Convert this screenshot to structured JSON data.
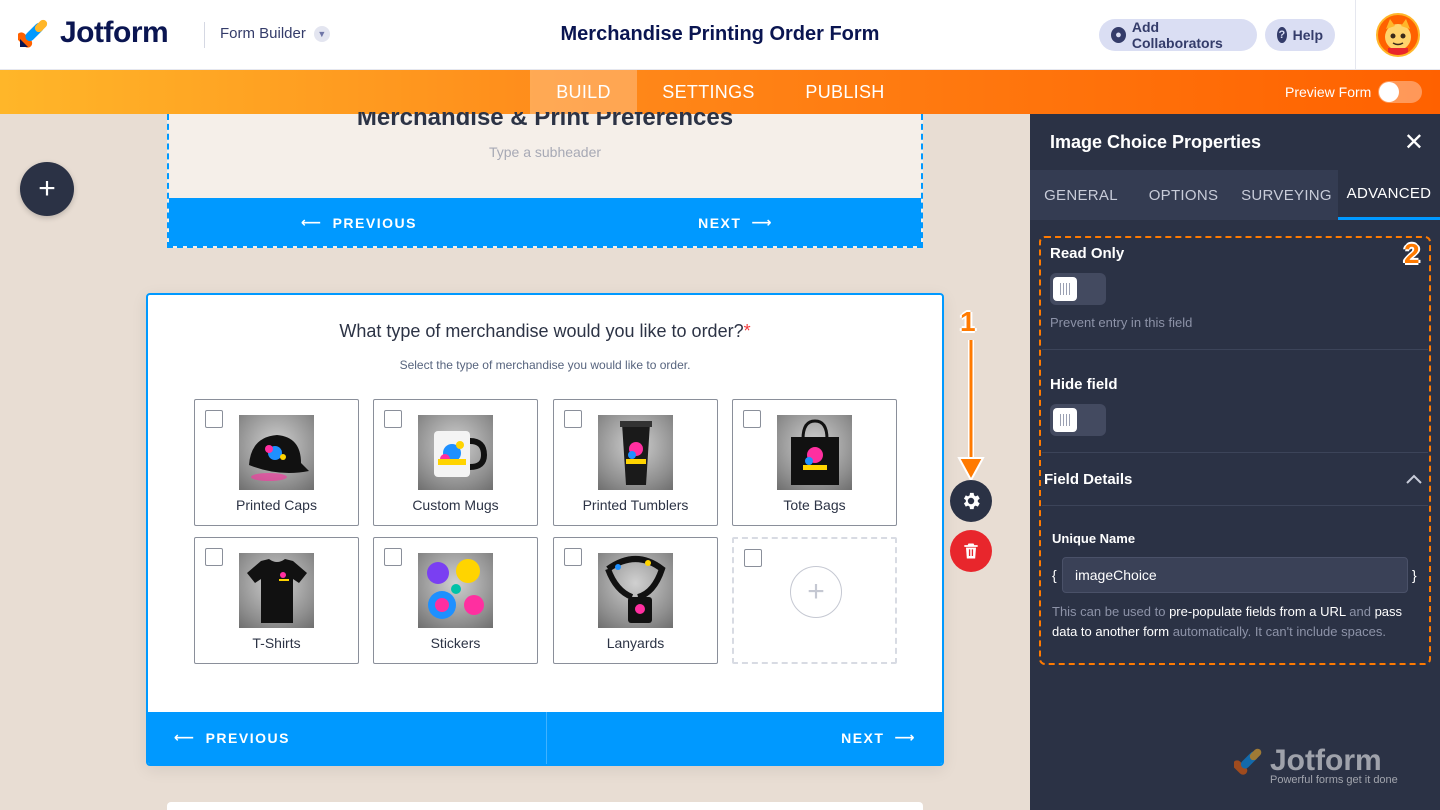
{
  "header": {
    "logo_text": "Jotform",
    "form_builder_label": "Form Builder",
    "form_title": "Merchandise Printing Order Form",
    "add_collaborators": "Add Collaborators",
    "help": "Help"
  },
  "navbar": {
    "tabs": [
      {
        "label": "BUILD",
        "active": true
      },
      {
        "label": "SETTINGS",
        "active": false
      },
      {
        "label": "PUBLISH",
        "active": false
      }
    ],
    "preview_label": "Preview Form",
    "preview_enabled": false
  },
  "prev_page": {
    "heading": "Merchandise & Print Preferences",
    "subheader_placeholder": "Type a subheader",
    "previous": "PREVIOUS",
    "next": "NEXT"
  },
  "question": {
    "title": "What type of merchandise would you like to order?",
    "required_mark": "*",
    "subtitle": "Select the type of merchandise you would like to order.",
    "choices": [
      {
        "label": "Printed Caps",
        "image": "cap"
      },
      {
        "label": "Custom Mugs",
        "image": "mug"
      },
      {
        "label": "Printed Tumblers",
        "image": "tumbler"
      },
      {
        "label": "Tote Bags",
        "image": "tote"
      },
      {
        "label": "T-Shirts",
        "image": "tshirt"
      },
      {
        "label": "Stickers",
        "image": "stickers"
      },
      {
        "label": "Lanyards",
        "image": "lanyard"
      }
    ],
    "previous": "PREVIOUS",
    "next": "NEXT"
  },
  "annotations": {
    "one": "1",
    "two": "2"
  },
  "panel": {
    "title": "Image Choice Properties",
    "tabs": [
      "GENERAL",
      "OPTIONS",
      "SURVEYING",
      "ADVANCED"
    ],
    "active_tab": "ADVANCED",
    "read_only_label": "Read Only",
    "read_only_help": "Prevent entry in this field",
    "hide_field_label": "Hide field",
    "field_details_label": "Field Details",
    "unique_name_label": "Unique Name",
    "unique_name_value": "imageChoice",
    "brace_open": "{",
    "brace_close": "}",
    "desc_1": "This can be used to ",
    "desc_2": "pre-populate fields from a URL",
    "desc_3": " and ",
    "desc_4": "pass data to another form",
    "desc_5": " automatically. It can't include spaces."
  },
  "watermark": {
    "brand": "Jotform",
    "tagline": "Powerful forms get it done"
  },
  "colors": {
    "brand_blue": "#0099ff",
    "brand_orange": "#ff6100",
    "panel_bg": "#2b3245",
    "annotation": "#ff7a00"
  }
}
